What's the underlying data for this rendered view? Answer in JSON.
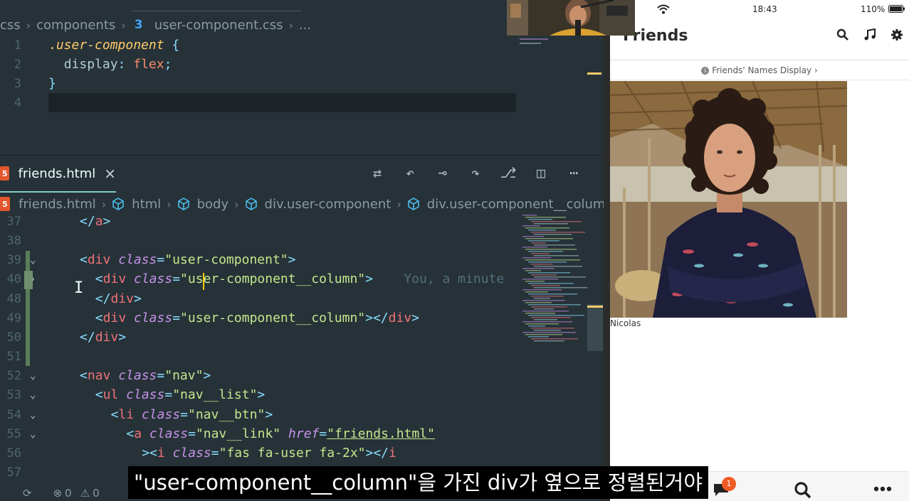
{
  "editor": {
    "css_breadcrumb": {
      "items": [
        "css",
        "components",
        "user-component.css",
        "..."
      ],
      "css_icon_glyph": "3"
    },
    "css_lines": [
      {
        "n": "1",
        "selector_dot": ".",
        "selector": "user-component",
        "brace": " {"
      },
      {
        "n": "2",
        "prop": "display",
        "colon": ": ",
        "value": "flex",
        "semi": ";"
      },
      {
        "n": "3",
        "close": "}"
      },
      {
        "n": "4"
      }
    ],
    "tab": {
      "label": "friends.html",
      "close": "×",
      "icon_letter": "5"
    },
    "html_breadcrumb": {
      "file": "friends.html",
      "items": [
        "html",
        "body",
        "div.user-component",
        "div.user-component__colum"
      ]
    },
    "actions": [
      "compare-icon",
      "go-back-icon",
      "timeline-icon",
      "go-forward-icon",
      "git-graph-icon",
      "split-editor-icon",
      "more-icon"
    ],
    "html_lines": [
      {
        "n": "37",
        "parts": [
          [
            "tk-punc",
            "</"
          ],
          [
            "tk-tag",
            "a"
          ],
          [
            "tk-punc",
            ">"
          ]
        ],
        "indent": 2
      },
      {
        "n": "38",
        "parts": [],
        "indent": 0
      },
      {
        "n": "39",
        "fold": "⌄",
        "parts": [
          [
            "tk-punc",
            "<"
          ],
          [
            "tk-tag",
            "div"
          ],
          [
            "tk-plain",
            " "
          ],
          [
            "tk-attr",
            "class"
          ],
          [
            "tk-punc",
            "="
          ],
          [
            "tk-str",
            "\"user-component\""
          ],
          [
            "tk-punc",
            ">"
          ]
        ],
        "indent": 2
      },
      {
        "n": "40",
        "fold": "›",
        "parts": [
          [
            "tk-punc",
            "<"
          ],
          [
            "tk-tag",
            "div"
          ],
          [
            "tk-plain",
            " "
          ],
          [
            "tk-attr",
            "class"
          ],
          [
            "tk-punc",
            "="
          ],
          [
            "tk-str",
            "\"user-component__column\""
          ],
          [
            "tk-punc",
            ">"
          ],
          [
            "tk-ghost",
            "    You, a minute"
          ]
        ],
        "indent": 3
      },
      {
        "n": "48",
        "parts": [
          [
            "tk-punc",
            "</"
          ],
          [
            "tk-tag",
            "div"
          ],
          [
            "tk-punc",
            ">"
          ]
        ],
        "indent": 3
      },
      {
        "n": "49",
        "parts": [
          [
            "tk-punc",
            "<"
          ],
          [
            "tk-tag",
            "div"
          ],
          [
            "tk-plain",
            " "
          ],
          [
            "tk-attr",
            "class"
          ],
          [
            "tk-punc",
            "="
          ],
          [
            "tk-str",
            "\"user-component__column\""
          ],
          [
            "tk-punc",
            "></"
          ],
          [
            "tk-tag",
            "div"
          ],
          [
            "tk-punc",
            ">"
          ]
        ],
        "indent": 3
      },
      {
        "n": "50",
        "parts": [
          [
            "tk-punc",
            "</"
          ],
          [
            "tk-tag",
            "div"
          ],
          [
            "tk-punc",
            ">"
          ]
        ],
        "indent": 2
      },
      {
        "n": "51",
        "parts": [],
        "indent": 0
      },
      {
        "n": "52",
        "fold": "⌄",
        "parts": [
          [
            "tk-punc",
            "<"
          ],
          [
            "tk-tag",
            "nav"
          ],
          [
            "tk-plain",
            " "
          ],
          [
            "tk-attr",
            "class"
          ],
          [
            "tk-punc",
            "="
          ],
          [
            "tk-str",
            "\"nav\""
          ],
          [
            "tk-punc",
            ">"
          ]
        ],
        "indent": 2
      },
      {
        "n": "53",
        "fold": "⌄",
        "parts": [
          [
            "tk-punc",
            "<"
          ],
          [
            "tk-tag",
            "ul"
          ],
          [
            "tk-plain",
            " "
          ],
          [
            "tk-attr",
            "class"
          ],
          [
            "tk-punc",
            "="
          ],
          [
            "tk-str",
            "\"nav__list\""
          ],
          [
            "tk-punc",
            ">"
          ]
        ],
        "indent": 3
      },
      {
        "n": "54",
        "fold": "⌄",
        "parts": [
          [
            "tk-punc",
            "<"
          ],
          [
            "tk-tag",
            "li"
          ],
          [
            "tk-plain",
            " "
          ],
          [
            "tk-attr",
            "class"
          ],
          [
            "tk-punc",
            "="
          ],
          [
            "tk-str",
            "\"nav__btn\""
          ],
          [
            "tk-punc",
            ">"
          ]
        ],
        "indent": 4
      },
      {
        "n": "55",
        "fold": "⌄",
        "parts": [
          [
            "tk-punc",
            "<"
          ],
          [
            "tk-tag",
            "a"
          ],
          [
            "tk-plain",
            " "
          ],
          [
            "tk-attr",
            "class"
          ],
          [
            "tk-punc",
            "="
          ],
          [
            "tk-str",
            "\"nav__link\""
          ],
          [
            "tk-plain",
            " "
          ],
          [
            "tk-attr",
            "href"
          ],
          [
            "tk-punc",
            "="
          ],
          [
            "tk-str",
            "\"friends.html\""
          ]
        ],
        "indent": 5
      },
      {
        "n": "56",
        "parts": [
          [
            "tk-punc",
            "><"
          ],
          [
            "tk-tag",
            "i"
          ],
          [
            "tk-plain",
            " "
          ],
          [
            "tk-attr",
            "class"
          ],
          [
            "tk-punc",
            "="
          ],
          [
            "tk-str",
            "\"fas fa-user fa-2x\""
          ],
          [
            "tk-punc",
            "></"
          ],
          [
            "tk-tag",
            "i"
          ]
        ],
        "indent": 6
      },
      {
        "n": "57",
        "parts": [
          [
            "tk-punc",
            ">"
          ]
        ],
        "indent": 6
      }
    ],
    "status": {
      "errors": "0",
      "warnings": "0"
    }
  },
  "phone": {
    "status": {
      "time": "18:43",
      "battery": "110%"
    },
    "title": "Friends",
    "header_icons": [
      "search-icon",
      "music-icon",
      "gear-icon"
    ],
    "notice": "Friends' Names Display",
    "notice_chevron": "›",
    "friend_name": "Nicolas",
    "badge": "1",
    "bottom_icons": [
      "chat-icon",
      "search-icon",
      "more-icon"
    ]
  },
  "subtitle": "\"user-component__column\"을 가진 div가 옆으로 정렬된거야",
  "colors": {
    "editor_bg": "#263238",
    "string": "#c3e88d",
    "tag": "#f07178",
    "attr": "#c792ea",
    "accent": "#80cbc4",
    "badge": "#f15a24"
  }
}
